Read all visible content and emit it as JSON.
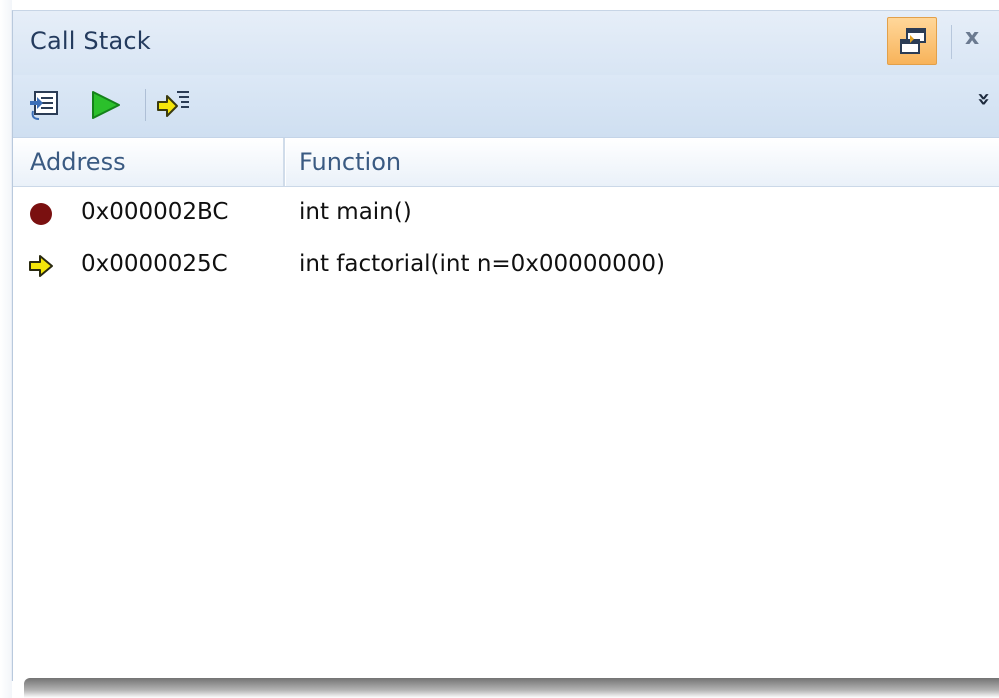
{
  "window": {
    "title": "Call Stack",
    "close_label": "x"
  },
  "toolbar": {
    "buttons": [
      {
        "icon": "show-source-icon"
      },
      {
        "icon": "run-to-frame-icon"
      },
      {
        "icon": "step-frame-icon"
      }
    ],
    "overflow_label": "»"
  },
  "table": {
    "columns": [
      "Address",
      "Function"
    ],
    "rows": [
      {
        "icon": "breakpoint-icon",
        "address": "0x000002BC",
        "function": "int main()"
      },
      {
        "icon": "current-frame-arrow-icon",
        "address": "0x0000025C",
        "function": "int factorial(int n=0x00000000)"
      }
    ]
  },
  "colors": {
    "title_bg": "#dfe9f6",
    "header_text": "#3a5a82",
    "breakpoint": "#7a1010",
    "arrow": "#f4e60a",
    "play_green": "#2bc02b",
    "pin_active": "#f8b35a"
  }
}
